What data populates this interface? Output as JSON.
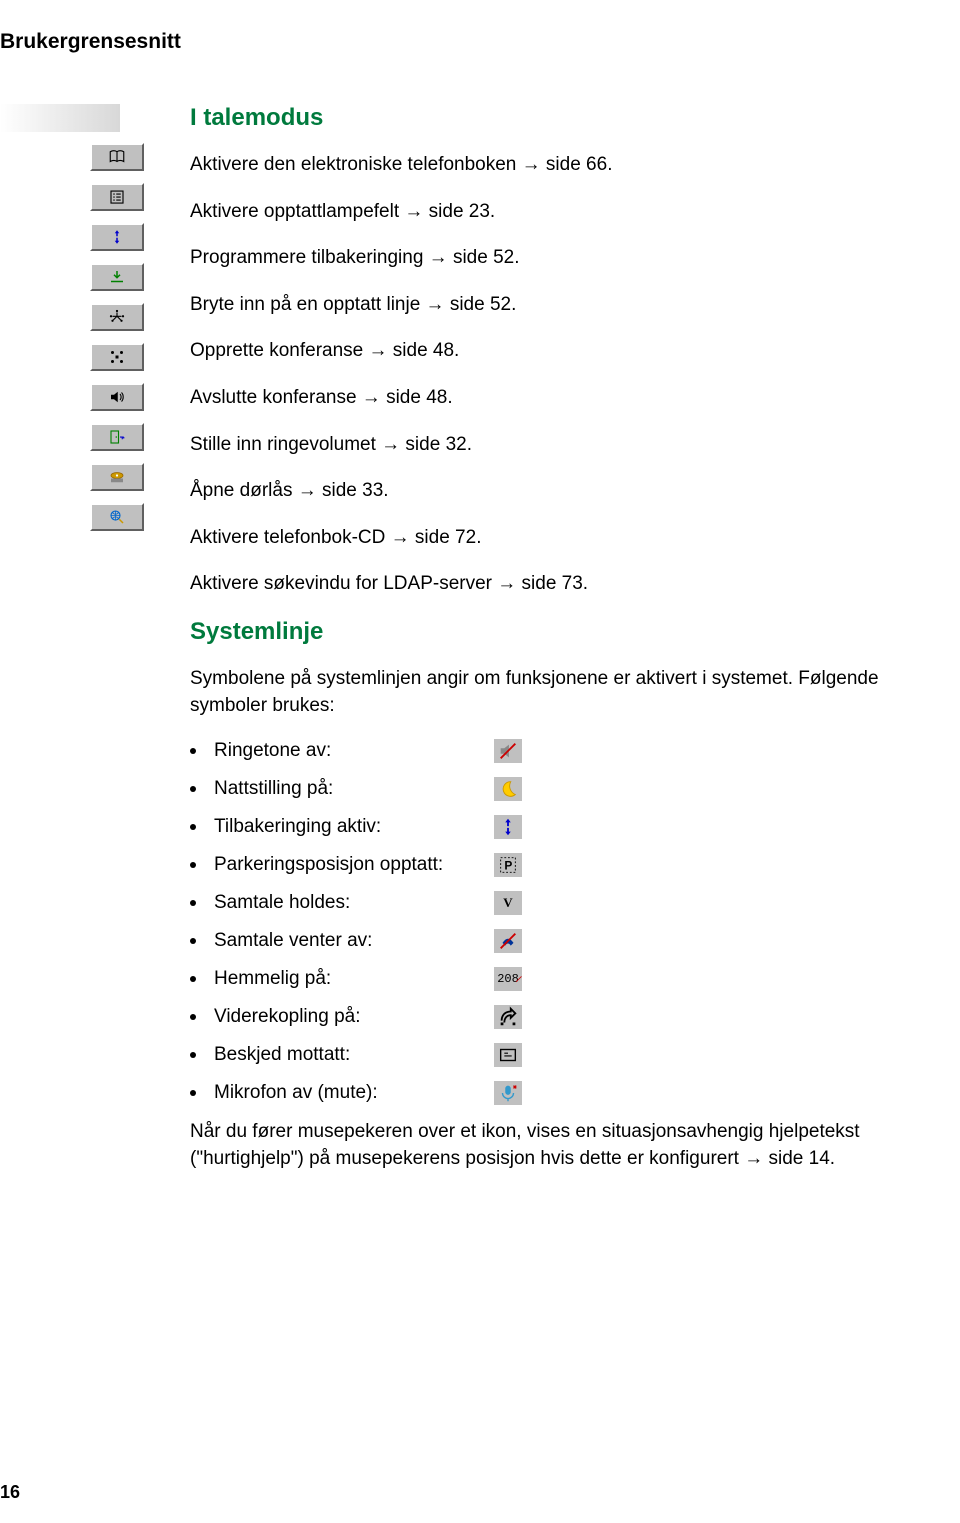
{
  "header": {
    "title": "Brukergrensesnitt"
  },
  "section1": {
    "title": "I talemodus",
    "items": [
      "Aktivere den elektroniske telefonboken → side 66.",
      "Aktivere opptattlampefelt → side 23.",
      "Programmere tilbakeringing → side 52.",
      "Bryte inn på en opptatt linje → side 52.",
      "Opprette konferanse → side 48.",
      "Avslutte konferanse → side 48.",
      "Stille inn ringevolumet → side 32.",
      "Åpne dørlås → side 33.",
      "Aktivere telefonbok-CD → side 72.",
      "Aktivere søkevindu for LDAP-server → side 73."
    ]
  },
  "section2": {
    "title": "Systemlinje",
    "intro": "Symbolene på systemlinjen angir om funksjonene er aktivert i systemet. Følgende symboler brukes:",
    "bullets": [
      "Ringetone av:",
      "Nattstilling på:",
      "Tilbakeringing aktiv:",
      "Parkeringsposisjon opptatt:",
      "Samtale holdes:",
      "Samtale venter av:",
      "Hemmelig på:",
      "Viderekopling på:",
      "Beskjed mottatt:",
      "Mikrofon av (mute):"
    ],
    "footer": "Når du fører musepekeren over et ikon, vises en situasjonsavhengig hjelpetekst (\"hurtighjelp\") på musepekerens posisjon hvis dette er konfigurert → side 14."
  },
  "page_number": "16"
}
